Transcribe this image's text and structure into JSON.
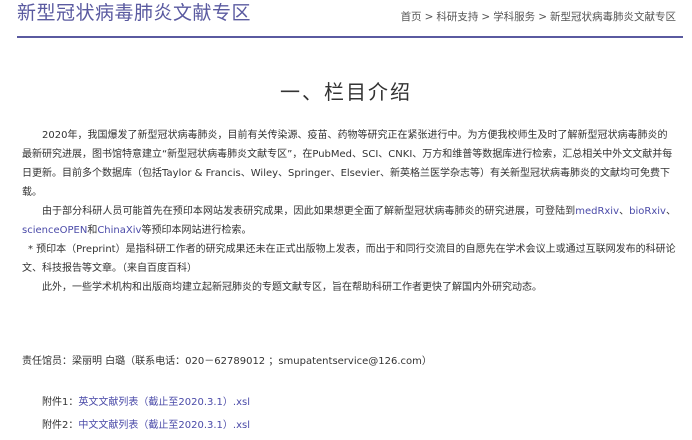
{
  "header": {
    "site_title": "新型冠状病毒肺炎文献专区",
    "breadcrumb": [
      "首页",
      "科研支持",
      "学科服务",
      "新型冠状病毒肺炎文献专区"
    ],
    "separator": ">"
  },
  "section_title": "一、栏目介绍",
  "paragraphs": {
    "p1": "2020年，我国爆发了新型冠状病毒肺炎，目前有关传染源、疫苗、药物等研究正在紧张进行中。为方便我校师生及时了解新型冠状病毒肺炎的最新研究进展，图书馆特意建立“新型冠状病毒肺炎文献专区”，在PubMed、SCI、CNKI、万方和维普等数据库进行检索，汇总相关中外文文献并每日更新。目前多个数据库（包括Taylor & Francis、Wiley、Springer、Elsevier、新英格兰医学杂志等）有关新型冠状病毒肺炎的文献均可免费下载。",
    "p2_before": "由于部分科研人员可能首先在预印本网站发表研究成果，因此如果想更全面了解新型冠状病毒肺炎的研究进展，可登陆到",
    "p2_links": [
      "medRxiv",
      "bioRxiv",
      "scienceOPEN",
      "ChinaXiv"
    ],
    "p2_sep1": "、",
    "p2_sep2": "、",
    "p2_and": "和",
    "p2_after": "等预印本网站进行检索。",
    "p3": "* 预印本（Preprint）是指科研工作者的研究成果还未在正式出版物上发表，而出于和同行交流目的自愿先在学术会议上或通过互联网发布的科研论文、科技报告等文章。（来自百度百科）",
    "p4": "此外，一些学术机构和出版商均建立起新冠肺炎的专题文献专区，旨在帮助科研工作者更快了解国内外研究动态。"
  },
  "contact": "责任馆员：梁丽明  白璐（联系电话：020－62789012 ；smupatentservice@126.com）",
  "attachments": [
    {
      "label": "附件1：",
      "link": "英文文献列表（截止至2020.3.1）.xsl"
    },
    {
      "label": "附件2：",
      "link": "中文文献列表（截止至2020.3.1）.xsl"
    }
  ],
  "colors": {
    "accent": "#5a5aa0",
    "link": "#4a4aa8"
  }
}
